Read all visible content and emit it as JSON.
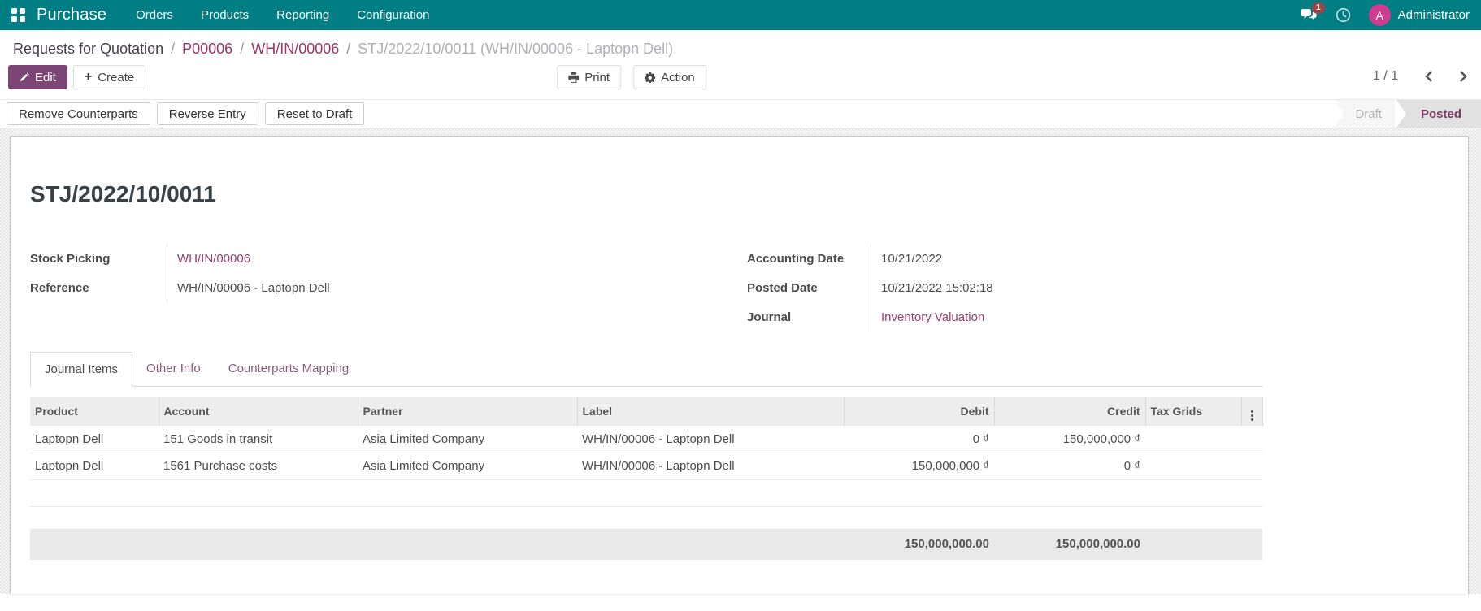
{
  "nav": {
    "app_name": "Purchase",
    "menus": [
      "Orders",
      "Products",
      "Reporting",
      "Configuration"
    ],
    "message_count": "1",
    "user_initial": "A",
    "user_name": "Administrator"
  },
  "breadcrumb": {
    "links": [
      "Requests for Quotation",
      "P00006",
      "WH/IN/00006"
    ],
    "current": "STJ/2022/10/0011 (WH/IN/00006 - Laptopn Dell)",
    "separator": "/"
  },
  "toolbar": {
    "edit_label": "Edit",
    "create_label": "Create",
    "print_label": "Print",
    "action_label": "Action",
    "pager_value": "1 / 1"
  },
  "status": {
    "buttons": [
      "Remove Counterparts",
      "Reverse Entry",
      "Reset to Draft"
    ],
    "states": [
      "Draft",
      "Posted"
    ],
    "active_state": "Posted"
  },
  "form": {
    "title": "STJ/2022/10/0011",
    "left_fields": [
      {
        "label": "Stock Picking",
        "value": "WH/IN/00006"
      },
      {
        "label": "Reference",
        "value": "WH/IN/00006 - Laptopn Dell"
      }
    ],
    "right_fields": [
      {
        "label": "Accounting Date",
        "value": "10/21/2022"
      },
      {
        "label": "Posted Date",
        "value": "10/21/2022 15:02:18"
      },
      {
        "label": "Journal",
        "value": "Inventory Valuation"
      }
    ],
    "tabs": [
      "Journal Items",
      "Other Info",
      "Counterparts Mapping"
    ],
    "active_tab": "Journal Items"
  },
  "journal_items": {
    "headers": [
      "Product",
      "Account",
      "Partner",
      "Label",
      "Debit",
      "Credit",
      "Tax Grids"
    ],
    "rows": [
      {
        "product": "Laptopn Dell",
        "account": "151 Goods in transit",
        "partner": "Asia Limited Company",
        "label": "WH/IN/00006 - Laptopn Dell",
        "debit": "0 ₫",
        "credit": "150,000,000 ₫"
      },
      {
        "product": "Laptopn Dell",
        "account": "1561 Purchase costs",
        "partner": "Asia Limited Company",
        "label": "WH/IN/00006 - Laptopn Dell",
        "debit": "150,000,000 ₫",
        "credit": "0 ₫"
      }
    ],
    "total_debit": "150,000,000.00",
    "total_credit": "150,000,000.00"
  },
  "colors": {
    "topbar": "#017e84",
    "primary_button": "#7c4576",
    "link": "#9b3d6f",
    "avatar_bg": "#cd3c8e",
    "badge_bg": "#a04444",
    "state_active_text": "#7d3c66"
  }
}
